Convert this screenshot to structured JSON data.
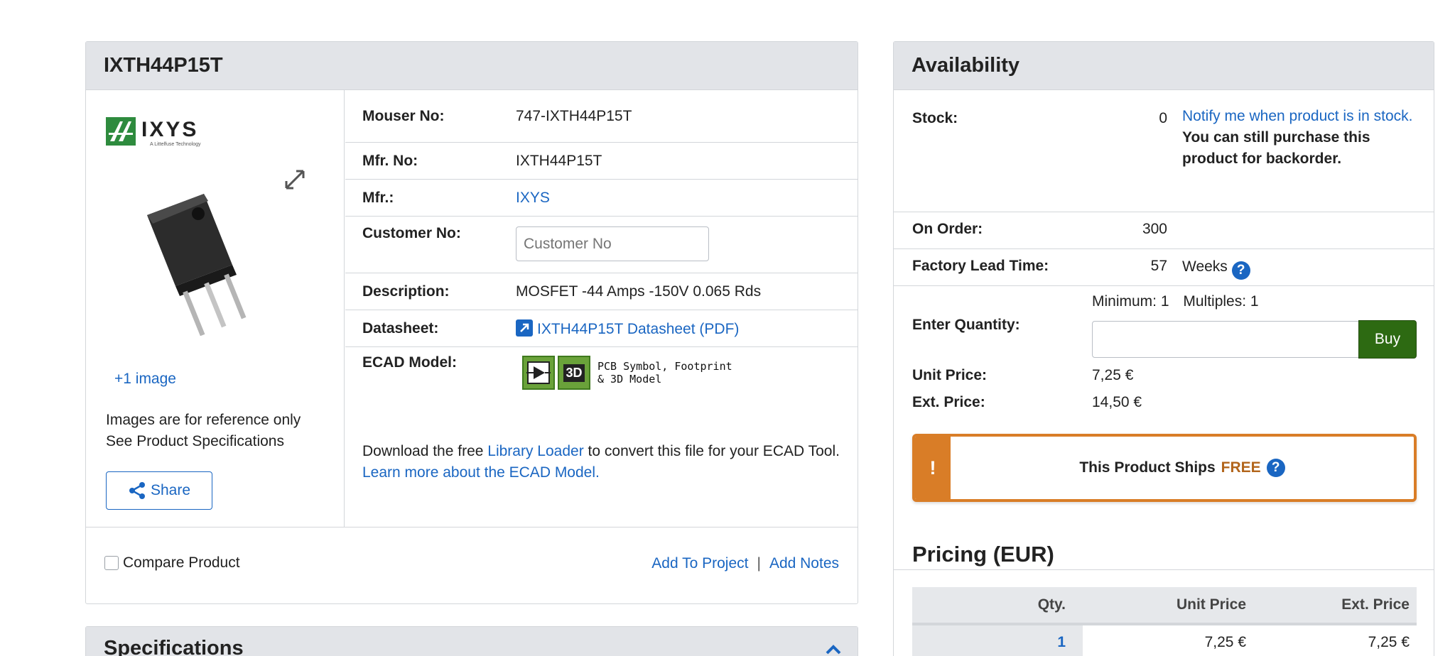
{
  "product": {
    "title": "IXTH44P15T",
    "brand_logo_text": "IXYS",
    "brand_logo_sub": "A Littelfuse Technology",
    "more_images": "+1 image",
    "ref_line1": "Images are for reference only",
    "ref_line2": "See Product Specifications",
    "share_label": "Share",
    "fields": {
      "mouser_no_label": "Mouser No:",
      "mouser_no": "747-IXTH44P15T",
      "mfr_no_label": "Mfr. No:",
      "mfr_no": "IXTH44P15T",
      "mfr_label": "Mfr.:",
      "mfr": "IXYS",
      "customer_no_label": "Customer No:",
      "customer_no_placeholder": "Customer No",
      "description_label": "Description:",
      "description": "MOSFET -44 Amps -150V 0.065 Rds",
      "datasheet_label": "Datasheet:",
      "datasheet_link": "IXTH44P15T Datasheet (PDF)",
      "ecad_label": "ECAD Model:",
      "ecad_caption_1": "PCB Symbol, Footprint",
      "ecad_caption_2": "& 3D Model",
      "ecad_3d": "3D",
      "ecad_text_1": "Download the free ",
      "ecad_link_loader": "Library Loader",
      "ecad_text_2": " to convert this file for your ECAD Tool. ",
      "ecad_link_learn": "Learn more about the ECAD Model."
    },
    "footer": {
      "compare_label": "Compare Product",
      "add_to_project": "Add To Project",
      "separator": "|",
      "add_notes": "Add Notes"
    }
  },
  "specifications": {
    "title": "Specifications"
  },
  "availability": {
    "title": "Availability",
    "stock_label": "Stock:",
    "stock_value": "0",
    "notify_link": "Notify me when product is in stock.",
    "backorder_note": "You can still purchase this product for backorder.",
    "on_order_label": "On Order:",
    "on_order_value": "300",
    "lead_time_label": "Factory Lead Time:",
    "lead_time_value": "57",
    "lead_time_unit": "Weeks",
    "minimum": "Minimum: 1",
    "multiples": "Multiples: 1",
    "enter_qty_label": "Enter Quantity:",
    "buy_label": "Buy",
    "unit_price_label": "Unit Price:",
    "unit_price": "7,25 €",
    "ext_price_label": "Ext. Price:",
    "ext_price": "14,50 €",
    "ship_bang": "!",
    "ship_text": "This Product Ships",
    "ship_free": "FREE",
    "help_glyph": "?"
  },
  "pricing": {
    "title": "Pricing (EUR)",
    "headers": [
      "Qty.",
      "Unit Price",
      "Ext. Price"
    ],
    "rows": [
      {
        "qty": "1",
        "unit": "7,25 €",
        "ext": "7,25 €"
      }
    ]
  },
  "colors": {
    "link": "#1a66c2",
    "header_bg": "#e2e4e8",
    "buy_green": "#2d6a12",
    "ship_orange": "#d97d27",
    "ecad_green": "#6aa23a"
  }
}
